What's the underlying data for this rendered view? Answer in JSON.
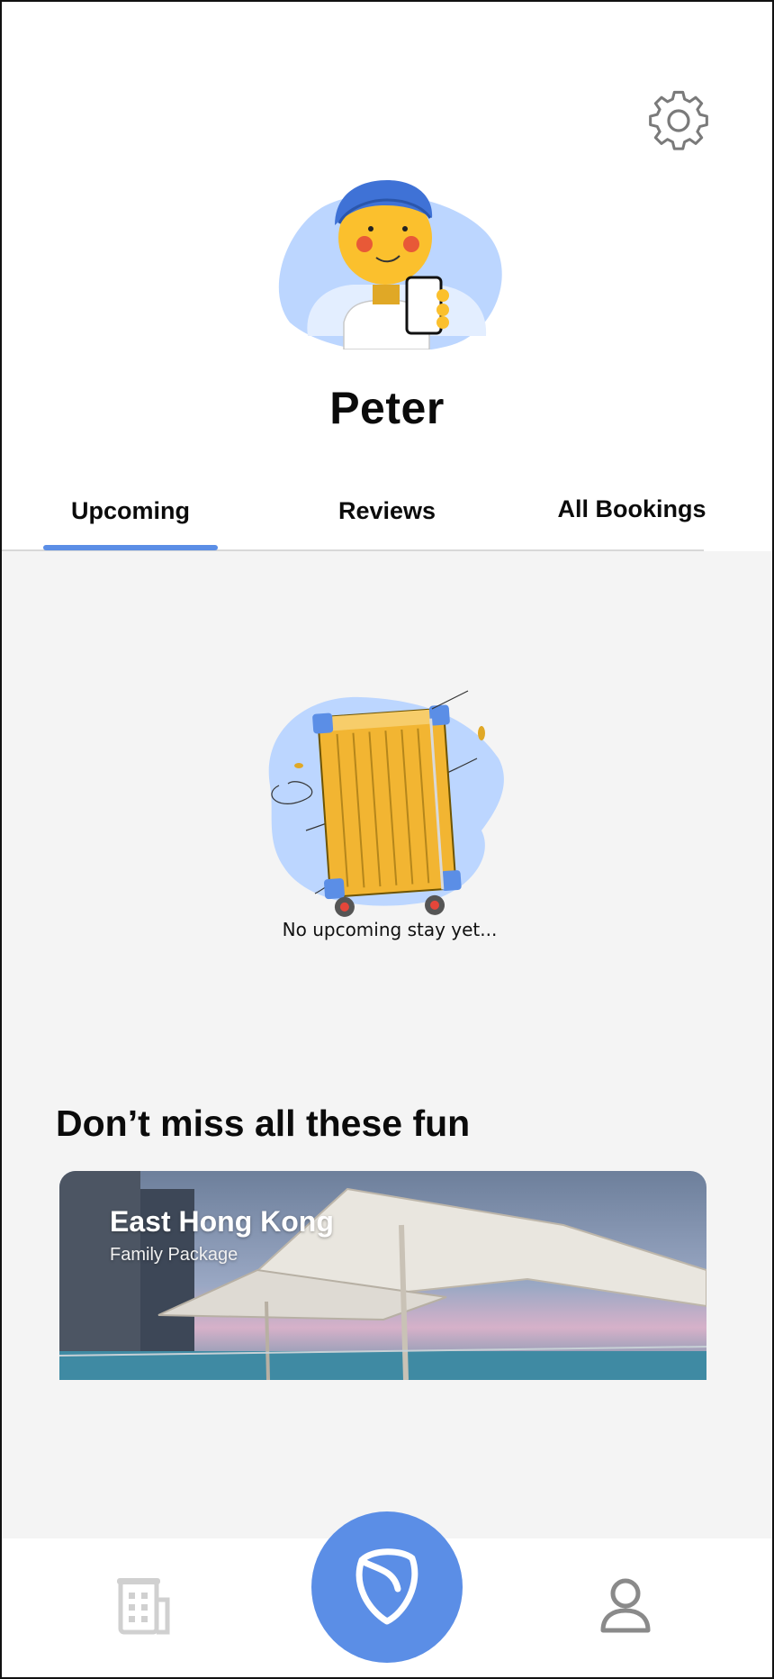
{
  "profile": {
    "name": "Peter"
  },
  "tabs": [
    {
      "label": "Upcoming",
      "active": true
    },
    {
      "label": "Reviews",
      "active": false
    },
    {
      "label": "All Bookings",
      "active": false
    }
  ],
  "upcoming": {
    "empty_message": "No upcoming stay yet..."
  },
  "promo": {
    "section_title": "Don’t miss all these fun",
    "cards": [
      {
        "title": "East Hong Kong",
        "subtitle": "Family Package"
      }
    ]
  },
  "icons": {
    "settings": "gear-icon",
    "nav_left": "hotel-building-icon",
    "nav_center": "brand-shield-icon",
    "nav_right": "user-profile-icon"
  },
  "colors": {
    "accent": "#5b8ee6",
    "background": "#f4f4f4",
    "text": "#0b0b0b"
  }
}
